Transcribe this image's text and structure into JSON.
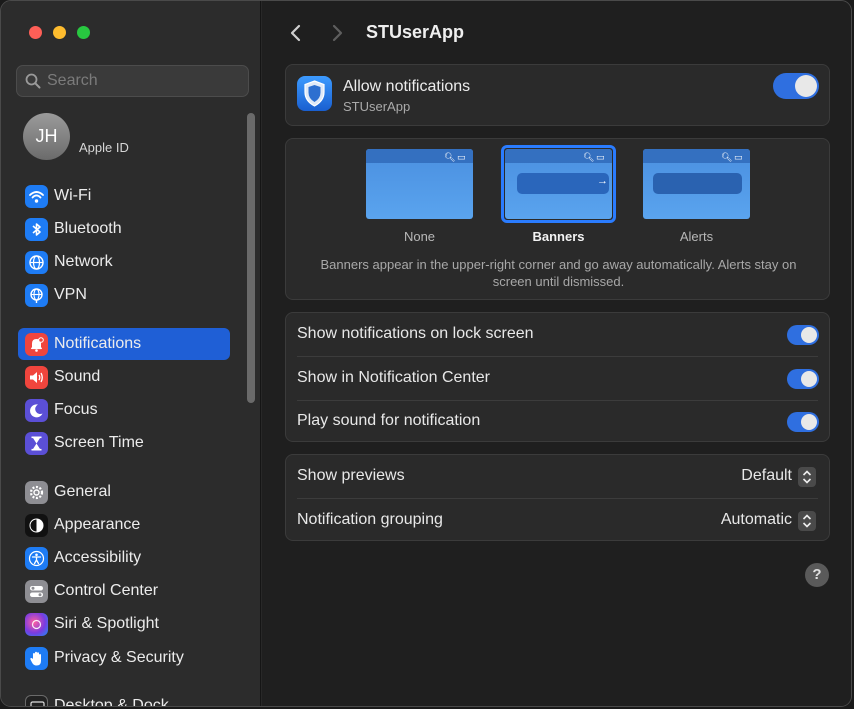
{
  "sidebar": {
    "search_placeholder": "Search",
    "account": {
      "initials": "JH",
      "label": "Apple ID"
    },
    "groups": [
      [
        {
          "label": "Wi-Fi",
          "icon": "wifi-icon",
          "color": "#1e7cf5"
        },
        {
          "label": "Bluetooth",
          "icon": "bluetooth-icon",
          "color": "#1e7cf5"
        },
        {
          "label": "Network",
          "icon": "globe-icon",
          "color": "#1e7cf5"
        },
        {
          "label": "VPN",
          "icon": "vpn-globe-icon",
          "color": "#1e7cf5"
        }
      ],
      [
        {
          "label": "Notifications",
          "icon": "bell-icon",
          "color": "#f0453d",
          "active": true
        },
        {
          "label": "Sound",
          "icon": "speaker-icon",
          "color": "#f0453d"
        },
        {
          "label": "Focus",
          "icon": "moon-icon",
          "color": "#5b4fd6"
        },
        {
          "label": "Screen Time",
          "icon": "hourglass-icon",
          "color": "#5b4fd6"
        }
      ],
      [
        {
          "label": "General",
          "icon": "gear-icon",
          "color": "#8e8e93"
        },
        {
          "label": "Appearance",
          "icon": "appearance-icon",
          "color": "#111111"
        },
        {
          "label": "Accessibility",
          "icon": "accessibility-icon",
          "color": "#1e7cf5"
        },
        {
          "label": "Control Center",
          "icon": "control-center-icon",
          "color": "#8e8e93"
        },
        {
          "label": "Siri & Spotlight",
          "icon": "siri-icon",
          "color": "#b44de0"
        },
        {
          "label": "Privacy & Security",
          "icon": "hand-icon",
          "color": "#1e7cf5"
        }
      ],
      [
        {
          "label": "Desktop & Dock",
          "icon": "dock-icon",
          "color": "#222222"
        }
      ]
    ]
  },
  "header": {
    "title": "STUserApp"
  },
  "allow": {
    "label": "Allow notifications",
    "sublabel": "STUserApp",
    "on": true
  },
  "alert_style": {
    "options": [
      {
        "label": "None",
        "selected": false
      },
      {
        "label": "Banners",
        "selected": true
      },
      {
        "label": "Alerts",
        "selected": false
      }
    ],
    "description": "Banners appear in the upper-right corner and go away automatically. Alerts stay on screen until dismissed."
  },
  "toggles": [
    {
      "label": "Show notifications on lock screen",
      "on": true
    },
    {
      "label": "Show in Notification Center",
      "on": true
    },
    {
      "label": "Play sound for notification",
      "on": true
    }
  ],
  "popups": [
    {
      "label": "Show previews",
      "value": "Default"
    },
    {
      "label": "Notification grouping",
      "value": "Automatic"
    }
  ],
  "help": {
    "label": "?"
  },
  "colors": {
    "accent": "#2f6fe0",
    "selection": "#1f5fd6",
    "red": "#fe5f57",
    "yellow": "#febc2e",
    "green": "#28c840"
  }
}
